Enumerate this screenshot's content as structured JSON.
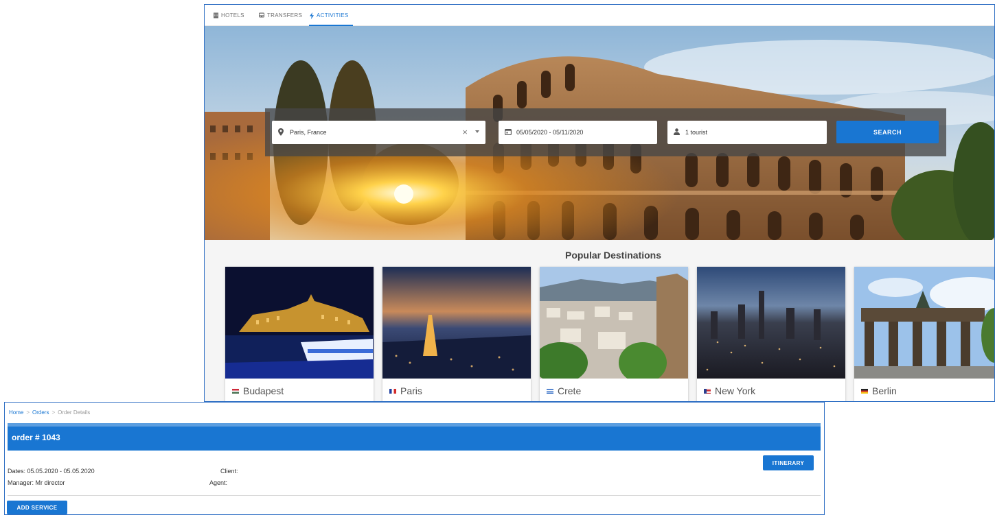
{
  "tabs": [
    {
      "label": "HOTELS",
      "icon": "hotel-icon",
      "active": false
    },
    {
      "label": "TRANSFERS",
      "icon": "bus-icon",
      "active": false
    },
    {
      "label": "ACTIVITIES",
      "icon": "bolt-icon",
      "active": true
    }
  ],
  "search": {
    "destination": "Paris, France",
    "dates": "05/05/2020 - 05/11/2020",
    "tourists": "1 tourist",
    "button_label": "SEARCH"
  },
  "popular": {
    "title": "Popular Destinations",
    "destinations": [
      {
        "name": "Budapest",
        "flag": "hungary-flag-icon"
      },
      {
        "name": "Paris",
        "flag": "france-flag-icon"
      },
      {
        "name": "Crete",
        "flag": "greece-flag-icon"
      },
      {
        "name": "New York",
        "flag": "usa-flag-icon"
      },
      {
        "name": "Berlin",
        "flag": "germany-flag-icon"
      }
    ]
  },
  "breadcrumb": {
    "home": "Home",
    "orders": "Orders",
    "current": "Order Details",
    "separator": ">"
  },
  "order": {
    "title": "order # 1043",
    "dates": "Dates: 05.05.2020 - 05.05.2020",
    "manager": "Manager: Mr director",
    "client": "Client:",
    "agent": "Agent:",
    "itinerary_label": "ITINERARY",
    "add_service_label": "ADD SERVICE"
  },
  "colors": {
    "accent": "#1976d2",
    "panel_border": "#2f6fc4",
    "search_overlay": "#464646"
  }
}
